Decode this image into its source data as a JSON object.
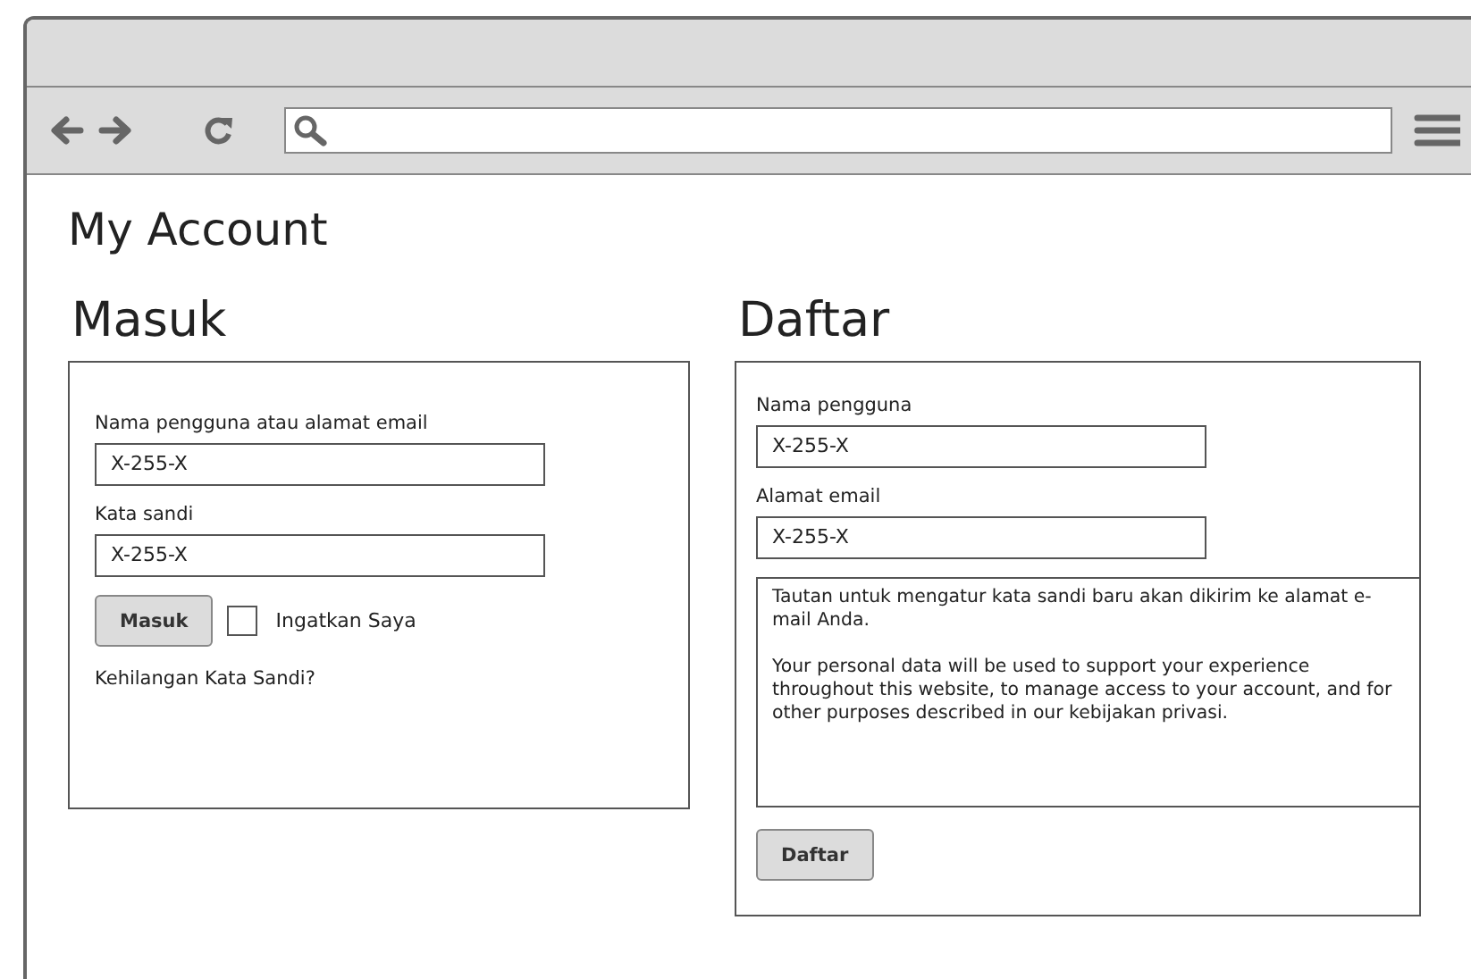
{
  "page_title": "My Account",
  "login": {
    "heading": "Masuk",
    "fields": [
      {
        "label": "Nama pengguna atau alamat email",
        "value": "X-255-X"
      },
      {
        "label": "Kata sandi",
        "value": "X-255-X"
      }
    ],
    "button": "Masuk",
    "remember": {
      "label": "Ingatkan Saya",
      "checked": false
    },
    "lost_password": "Kehilangan Kata Sandi?"
  },
  "register": {
    "heading": "Daftar",
    "fields": [
      {
        "label": "Nama pengguna",
        "value": "X-255-X"
      },
      {
        "label": "Alamat email",
        "value": "X-255-X"
      }
    ],
    "notice": [
      "Tautan untuk mengatur kata sandi baru akan dikirim ke alamat e-mail Anda.",
      "Your personal data will be used to support your experience throughout this website, to manage access to your account, and for other purposes described in our kebijakan privasi."
    ],
    "button": "Daftar"
  }
}
